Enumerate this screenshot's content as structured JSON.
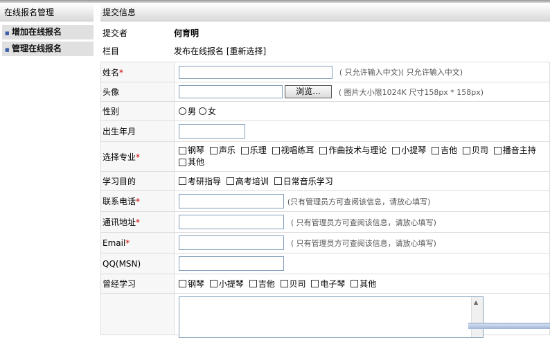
{
  "sidebar": {
    "title": "在线报名管理",
    "items": [
      {
        "label": "增加在线报名"
      },
      {
        "label": "管理在线报名"
      }
    ]
  },
  "main": {
    "title": "提交信息",
    "submitter": {
      "label": "提交者",
      "value": "何育明"
    },
    "column": {
      "label": "栏目",
      "value": "发布在线报名 [重新选择]"
    }
  },
  "form": {
    "name": {
      "label": "姓名",
      "required": "*",
      "hint": "( 只允许输入中文)( 只允许输入中文)"
    },
    "avatar": {
      "label": "头像",
      "browse": "浏览...",
      "hint": "( 图片大小限1024K 尺寸158px * 158px)"
    },
    "gender": {
      "label": "性别",
      "options": [
        "男",
        "女"
      ]
    },
    "birth": {
      "label": "出生年月"
    },
    "major": {
      "label": "选择专业",
      "required": "*",
      "options": [
        "钢琴",
        "声乐",
        "乐理",
        "视唱练耳",
        "作曲技术与理论",
        "小提琴",
        "吉他",
        "贝司",
        "播音主持",
        "其他"
      ]
    },
    "purpose": {
      "label": "学习目的",
      "options": [
        "考研指导",
        "高考培训",
        "日常音乐学习"
      ]
    },
    "phone": {
      "label": "联系电话",
      "required": "*",
      "hint": "(只有管理员方可查阅该信息，请放心填写)"
    },
    "address": {
      "label": "通讯地址",
      "required": "*",
      "hint": "( 只有管理员方可查阅该信息，请放心填写)"
    },
    "email": {
      "label": "Email",
      "required": "*",
      "hint": "( 只有管理员方可查阅该信息，请放心填写)"
    },
    "qq": {
      "label": "QQ(MSN)"
    },
    "studied": {
      "label": "曾经学习",
      "options": [
        "钢琴",
        "小提琴",
        "吉他",
        "贝司",
        "电子琴",
        "其他"
      ]
    }
  }
}
